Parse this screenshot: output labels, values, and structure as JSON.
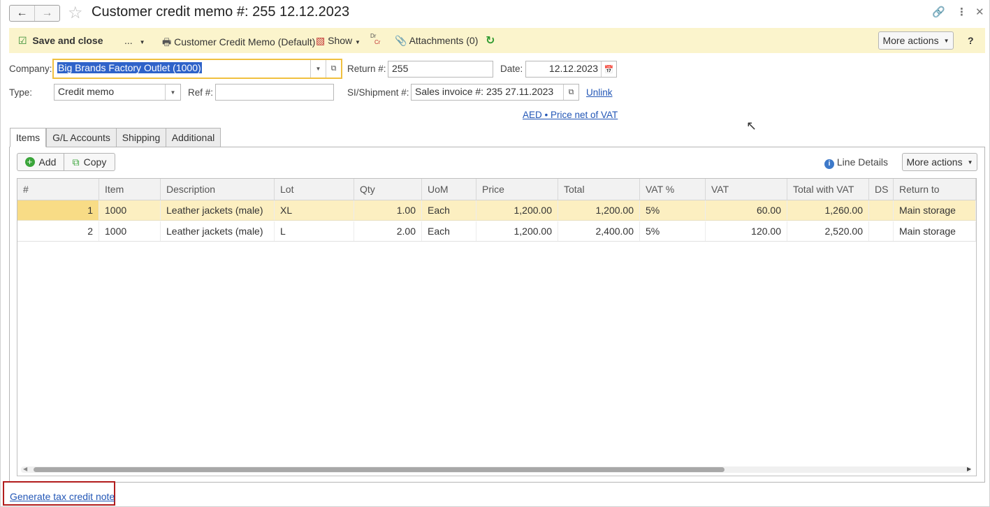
{
  "window": {
    "title": "Customer credit memo #: 255 12.12.2023"
  },
  "toolbar": {
    "save_close": "Save and close",
    "ellipsis": "...",
    "print_label": "Customer Credit Memo (Default)",
    "show_label": "Show",
    "drcr_dr": "Dr",
    "drcr_cr": "Cr",
    "attachments_label": "Attachments (0)",
    "more_actions": "More actions",
    "help": "?"
  },
  "form": {
    "company_label": "Company:",
    "company_value": "Big Brands Factory Outlet (1000)",
    "return_label": "Return #:",
    "return_value": "255",
    "date_label": "Date:",
    "date_value": "12.12.2023",
    "type_label": "Type:",
    "type_value": "Credit memo",
    "ref_label": "Ref #:",
    "ref_value": "",
    "si_label": "SI/Shipment #:",
    "si_value": "Sales invoice #: 235 27.11.2023",
    "unlink": "Unlink",
    "currency_link": "AED • Price net of VAT"
  },
  "tabs": [
    {
      "label": "Items"
    },
    {
      "label": "G/L Accounts"
    },
    {
      "label": "Shipping"
    },
    {
      "label": "Additional"
    }
  ],
  "items_toolbar": {
    "add": "Add",
    "copy": "Copy",
    "line_details": "Line Details",
    "more_actions": "More actions"
  },
  "table": {
    "columns": [
      "#",
      "Item",
      "Description",
      "Lot",
      "Qty",
      "UoM",
      "Price",
      "Total",
      "VAT %",
      "VAT",
      "Total with VAT",
      "DS",
      "Return to"
    ],
    "rows": [
      {
        "n": "1",
        "item": "1000",
        "description": "Leather jackets (male)",
        "lot": "XL",
        "qty": "1.00",
        "uom": "Each",
        "price": "1,200.00",
        "total": "1,200.00",
        "vat_pct": "5%",
        "vat": "60.00",
        "total_vat": "1,260.00",
        "ds": "",
        "return_to": "Main storage"
      },
      {
        "n": "2",
        "item": "1000",
        "description": "Leather jackets (male)",
        "lot": "L",
        "qty": "2.00",
        "uom": "Each",
        "price": "1,200.00",
        "total": "2,400.00",
        "vat_pct": "5%",
        "vat": "120.00",
        "total_vat": "2,520.00",
        "ds": "",
        "return_to": "Main storage"
      }
    ]
  },
  "footer": {
    "generate_link": "Generate tax credit note"
  },
  "colors": {
    "command_bar": "#fbf4cc",
    "selected_row": "#fcefc1",
    "link": "#2256b6",
    "highlight_box": "#b21d1d"
  }
}
